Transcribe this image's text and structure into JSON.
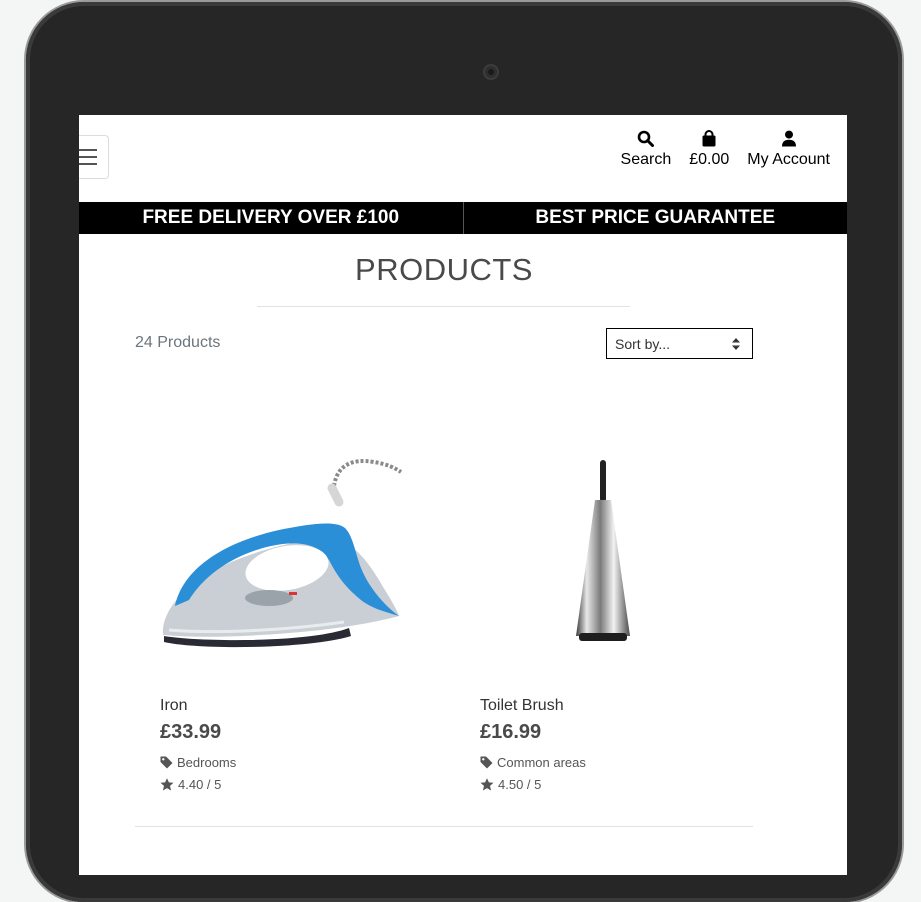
{
  "header": {
    "menu_icon": "hamburger-icon",
    "nav": [
      {
        "icon": "search-icon",
        "label": "Search"
      },
      {
        "icon": "shopping-bag-icon",
        "label": "£0.00"
      },
      {
        "icon": "user-icon",
        "label": "My Account"
      }
    ]
  },
  "banner": {
    "left": "FREE DELIVERY OVER £100",
    "right": "BEST PRICE GUARANTEE"
  },
  "main": {
    "title": "PRODUCTS",
    "count": "24 Products",
    "sort": {
      "selected": "Sort by..."
    }
  },
  "products": [
    {
      "name": "Iron",
      "price": "£33.99",
      "category": "Bedrooms",
      "rating": "4.40 / 5",
      "image_icon": "iron-image"
    },
    {
      "name": "Toilet Brush",
      "price": "£16.99",
      "category": "Common areas",
      "rating": "4.50 / 5",
      "image_icon": "toilet-brush-image"
    }
  ],
  "colors": {
    "banner_bg": "#000000",
    "banner_text": "#ffffff",
    "iron_blue": "#2b8fd8"
  }
}
